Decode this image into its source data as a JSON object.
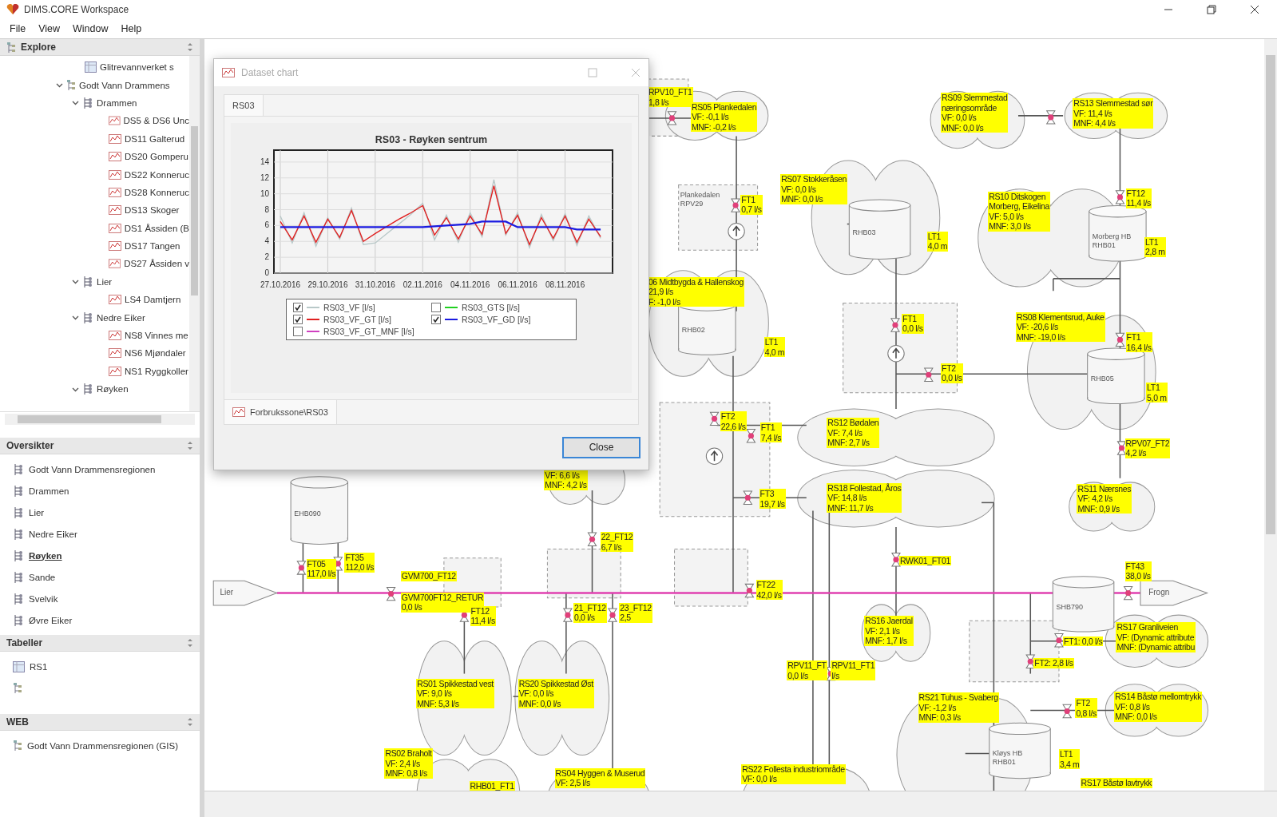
{
  "window": {
    "title": "DIMS.CORE Workspace"
  },
  "menu": [
    "File",
    "View",
    "Window",
    "Help"
  ],
  "explore": {
    "title": "Explore",
    "tree": [
      {
        "label": "Glitrevannverket s",
        "kind": "table"
      },
      {
        "label": "Godt Vann Drammens",
        "kind": "network",
        "expanded": true,
        "children": [
          {
            "label": "Drammen",
            "kind": "area",
            "expanded": true,
            "children": [
              {
                "label": "DS5 & DS6 Unc",
                "kind": "dataset"
              },
              {
                "label": "DS11 Galterud",
                "kind": "dataset"
              },
              {
                "label": "DS20 Gomperu",
                "kind": "dataset"
              },
              {
                "label": "DS22 Konneruc",
                "kind": "dataset"
              },
              {
                "label": "DS28 Konneruc",
                "kind": "dataset"
              },
              {
                "label": "DS13 Skoger",
                "kind": "dataset"
              },
              {
                "label": "DS1 Åssiden (B",
                "kind": "dataset"
              },
              {
                "label": "DS17 Tangen",
                "kind": "dataset"
              },
              {
                "label": "DS27 Åssiden v",
                "kind": "dataset"
              }
            ]
          },
          {
            "label": "Lier",
            "kind": "area",
            "expanded": true,
            "children": [
              {
                "label": "LS4 Damtjern",
                "kind": "dataset"
              }
            ]
          },
          {
            "label": "Nedre Eiker",
            "kind": "area",
            "expanded": true,
            "children": [
              {
                "label": "NS8 Vinnes me",
                "kind": "dataset"
              },
              {
                "label": "NS6 Mjøndaler",
                "kind": "dataset"
              },
              {
                "label": "NS1 Ryggkoller",
                "kind": "dataset"
              }
            ]
          },
          {
            "label": "Røyken",
            "kind": "area",
            "expanded": true
          }
        ]
      }
    ]
  },
  "oversikter": {
    "title": "Oversikter",
    "items": [
      {
        "label": "Godt Vann Drammensregionen",
        "selected": false
      },
      {
        "label": "Drammen",
        "selected": false
      },
      {
        "label": "Lier",
        "selected": false
      },
      {
        "label": "Nedre Eiker",
        "selected": false
      },
      {
        "label": "Røyken",
        "selected": true
      },
      {
        "label": "Sande",
        "selected": false
      },
      {
        "label": "Svelvik",
        "selected": false
      },
      {
        "label": "Øvre Eiker",
        "selected": false
      }
    ]
  },
  "tabeller": {
    "title": "Tabeller",
    "items": [
      {
        "label": "RS1",
        "kind": "table"
      },
      {
        "kind": "network"
      }
    ]
  },
  "web": {
    "title": "WEB",
    "items": [
      {
        "label": "Godt Vann Drammensregionen (GIS)",
        "kind": "network"
      }
    ]
  },
  "dialog": {
    "title": "Dataset chart",
    "tabs": [
      {
        "label": "RS03",
        "selected": true
      }
    ],
    "chart_data": {
      "type": "line",
      "title": "RS03 - Røyken sentrum",
      "ylim": [
        0,
        15.5
      ],
      "yticks": [
        0,
        2,
        4,
        6,
        8,
        10,
        12,
        14
      ],
      "categories": [
        "27.10.2016",
        null,
        null,
        null,
        "29.10.2016",
        null,
        null,
        null,
        "31.10.2016",
        null,
        null,
        null,
        "02.11.2016",
        null,
        null,
        null,
        "04.11.2016",
        null,
        null,
        null,
        "06.11.2016",
        null,
        null,
        null,
        "08.11.2016",
        null,
        null,
        null
      ],
      "series": [
        {
          "name": "RS03_VF [l/s]",
          "color": "#b8c8c8",
          "values": [
            7.2,
            3.8,
            7.6,
            3.4,
            7.0,
            4.3,
            8.2,
            3.6,
            3.8,
            5.0,
            6.2,
            7.4,
            8.8,
            4.2,
            7.3,
            3.9,
            7.6,
            4.6,
            11.8,
            4.8,
            7.6,
            3.2,
            7.4,
            4.1,
            7.5,
            3.5,
            7.2,
            4.4
          ]
        },
        {
          "name": "RS03_VF_GT [l/s]",
          "color": "#e02020",
          "values": [
            6.5,
            4.2,
            7.2,
            3.9,
            6.8,
            4.5,
            7.9,
            4.0,
            5.0,
            5.9,
            6.8,
            7.6,
            8.5,
            4.8,
            7.0,
            4.3,
            7.2,
            4.9,
            11.0,
            5.0,
            7.3,
            3.6,
            7.0,
            4.4,
            7.2,
            3.9,
            6.8,
            4.6
          ]
        },
        {
          "name": "RS03_VF_GD [l/s]",
          "color": "#1a1ae0",
          "values": [
            5.8,
            5.8,
            5.8,
            5.8,
            5.8,
            5.8,
            5.8,
            5.8,
            5.8,
            5.8,
            5.8,
            5.8,
            5.8,
            5.9,
            6.0,
            6.1,
            6.2,
            6.5,
            6.5,
            6.5,
            5.8,
            5.8,
            5.8,
            5.8,
            5.8,
            5.5,
            5.5,
            5.5
          ]
        }
      ],
      "grid": true
    },
    "legend": [
      {
        "checked": true
      },
      {
        "label": "RS03_GTS [l/s]",
        "color": "#20d020",
        "checked": false
      },
      {
        "checked": true
      },
      {
        "checked": true
      },
      {
        "label": "RS03_VF_GT_MNF [l/s]",
        "color": "#d040c0",
        "checked": false
      }
    ],
    "source_tabs": [
      {
        "label": "Forbrukssone\\RS03",
        "selected": true
      }
    ],
    "button": "Close"
  },
  "diagram": {
    "terminals": [
      {
        "label": "Lier"
      },
      {
        "label": "Frogn"
      }
    ],
    "stations": [
      {
        "lines": [
          "Plankedalen",
          "RPV29"
        ]
      }
    ],
    "tanks": [
      {
        "lines": [
          "RHB03"
        ]
      },
      {
        "lines": [
          "RHB02"
        ]
      },
      {
        "lines": [
          "Morberg HB",
          "RHB01"
        ]
      },
      {
        "lines": [
          "RHB05"
        ]
      },
      {
        "lines": [
          "EHB090"
        ]
      },
      {
        "lines": [
          "SHB790"
        ]
      },
      {
        "lines": [
          "Kløys HB",
          "RHB01"
        ]
      }
    ],
    "labels": [
      {
        "lines": [
          "RPV10_FT1",
          "1,8 l/s"
        ]
      },
      {
        "lines": [
          "RS05 Plankedalen",
          "VF: -0,1 l/s",
          "MNF: -0,2 l/s"
        ]
      },
      {
        "lines": [
          "RS09 Slemmestad",
          "næringsområde",
          "VF: 0,0 l/s",
          "MNF: 0,0 l/s"
        ]
      },
      {
        "lines": [
          "RS13 Slemmestad sør",
          "VF: 11,4 l/s",
          "MNF: 4,4 l/s"
        ]
      },
      {
        "lines": [
          "RS07 Stokkeråsen",
          "VF: 0,0 l/s",
          "MNF: 0,0 l/s"
        ]
      },
      {
        "lines": [
          "FT1",
          "0,7 l/s"
        ]
      },
      {
        "lines": [
          "RS10 Ditskogen",
          "Morberg, Eikelina",
          "VF: 5,0 l/s",
          "MNF: 3,0 l/s"
        ]
      },
      {
        "lines": [
          "FT12",
          "11,4 l/s"
        ]
      },
      {
        "lines": [
          "LT1",
          "4,0 m"
        ]
      },
      {
        "lines": [
          "LT1",
          "2,8 m"
        ]
      },
      {
        "lines": [
          "06 Midtbygda & Hallenskog",
          "21,9 l/s",
          "F: -1,0 l/s"
        ]
      },
      {
        "lines": [
          "LT1",
          "4,0 m"
        ]
      },
      {
        "lines": [
          "FT1",
          "0,0 l/s"
        ]
      },
      {
        "lines": [
          "RS08 Klementsrud, Auke",
          "VF: -20,6 l/s",
          "MNF: -19,0 l/s"
        ]
      },
      {
        "lines": [
          "FT1",
          "16,4 l/s"
        ]
      },
      {
        "lines": [
          "FT2",
          "0,0 l/s"
        ]
      },
      {
        "lines": [
          "LT1",
          "5,0 m"
        ]
      },
      {
        "lines": [
          "FT2",
          "22,6 l/s"
        ]
      },
      {
        "lines": [
          "FT1",
          "7,4 l/s"
        ]
      },
      {
        "lines": [
          "RS12 Bødalen",
          "VF: 7,4 l/s",
          "MNF: 2,7 l/s"
        ]
      },
      {
        "lines": [
          "RPV07_FT2",
          "4,2 l/s"
        ]
      },
      {
        "lines": [
          "VF: 6,6 l/s",
          "MNF: 4,2 l/s"
        ]
      },
      {
        "lines": [
          "FT3",
          "19,7 l/s"
        ]
      },
      {
        "lines": [
          "RS18 Follestad, Åros",
          "VF: 14,8 l/s",
          "MNF: 11,7 l/s"
        ]
      },
      {
        "lines": [
          "RS11 Nærsnes",
          "VF: 4,2 l/s",
          "MNF: 0,9 l/s"
        ]
      },
      {
        "lines": [
          "22_FT12",
          "6,7 l/s"
        ]
      },
      {
        "lines": [
          "RWK01_FT01"
        ]
      },
      {
        "lines": [
          "FT05",
          "117,0 l/s"
        ]
      },
      {
        "lines": [
          "FT35",
          "112,0 l/s"
        ]
      },
      {
        "lines": [
          "GVM700_FT12"
        ]
      },
      {
        "lines": [
          "GVM700FT12_RETUR",
          "0,0 l/s"
        ]
      },
      {
        "lines": [
          "FT43",
          "38,0 l/s"
        ]
      },
      {
        "lines": [
          "FT22",
          "42,0 l/s"
        ]
      },
      {
        "lines": [
          "FT12",
          "11,4 l/s"
        ]
      },
      {
        "lines": [
          "21_FT12",
          "0,0 l/s"
        ]
      },
      {
        "lines": [
          "23_FT12",
          "2,5"
        ]
      },
      {
        "lines": [
          "RS16 Jaerdal",
          "VF: 2,1 l/s",
          "MNF: 1,7 l/s"
        ]
      },
      {
        "lines": [
          "FT1: 0,0 l/s"
        ]
      },
      {
        "lines": [
          "RS17 Granliveien",
          "VF: (Dynamic attribute",
          "MNF: (Dynamic attribu"
        ]
      },
      {
        "lines": [
          "RPV11_FT",
          "0,0 l/s"
        ]
      },
      {
        "lines": [
          "RPV11_FT1",
          "l/s"
        ]
      },
      {
        "lines": [
          "FT2: 2,8 l/s"
        ]
      },
      {
        "lines": [
          "RS01 Spikkestad vest",
          "VF: 9,0 l/s",
          "MNF: 5,3 l/s"
        ]
      },
      {
        "lines": [
          "RS20 Spikkestad Øst",
          "VF: 0,0 l/s",
          "MNF: 0,0 l/s"
        ]
      },
      {
        "lines": [
          "RS21 Tuhus - Svaberg",
          "VF: -1,2 l/s",
          "MNF: 0,3 l/s"
        ]
      },
      {
        "lines": [
          "FT2",
          "0,8 l/s"
        ]
      },
      {
        "lines": [
          "RS14 Båstø mellomtrykk",
          "VF: 0,8 l/s",
          "MNF: 0,0 l/s"
        ]
      },
      {
        "lines": [
          "RS02 Braholt",
          "VF: 2,4 l/s",
          "MNF: 0,8 l/s"
        ]
      },
      {
        "lines": [
          "LT1",
          "3,4 m"
        ]
      },
      {
        "lines": [
          "RS22 Follesta industriområde",
          "VF: 0,0 l/s"
        ]
      },
      {
        "lines": [
          "RHB01_FT1"
        ]
      },
      {
        "lines": [
          "RS04 Hyggen & Muserud",
          "VF: 2,5 l/s"
        ]
      },
      {
        "lines": [
          "RS17 Båstø lavtrykk"
        ]
      }
    ]
  }
}
